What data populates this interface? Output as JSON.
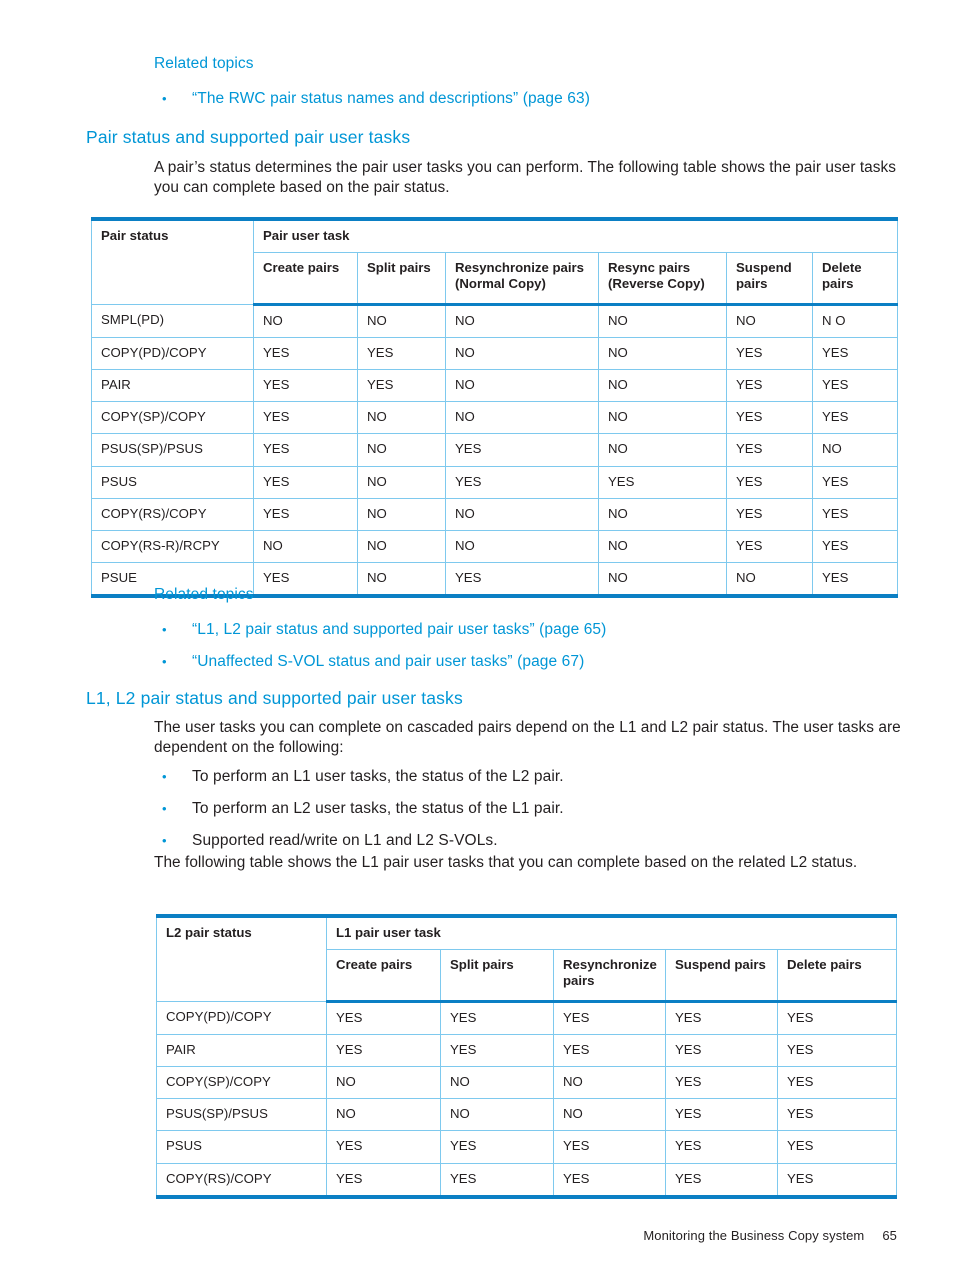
{
  "page": {
    "footer_title": "Monitoring the Business Copy system",
    "footer_page_number": "65",
    "accent_color": "#0096d6",
    "table_rule_color": "#0b7fc4",
    "table_grid_color": "#7ec9ee"
  },
  "related_topics_1": {
    "label": "Related topics",
    "items": [
      {
        "bullet": "•",
        "text": "“The RWC pair status names and descriptions” (page 63)"
      }
    ]
  },
  "section_1": {
    "heading": "Pair status and supported pair user tasks",
    "intro": "A pair’s status determines the pair user tasks you can perform. The following table shows the pair user tasks you can complete based on the pair status."
  },
  "table_1": {
    "row_header_label": "Pair status",
    "group_header_label": "Pair user task",
    "columns": [
      "Create pairs",
      "Split pairs",
      "Resynchronize pairs (Normal Copy)",
      "Resync pairs (Reverse Copy)",
      "Suspend pairs",
      "Delete pairs"
    ],
    "columns_wrapped": [
      [
        "Create pairs"
      ],
      [
        "Split pairs"
      ],
      [
        "Resynchronize pairs",
        "(Normal Copy)"
      ],
      [
        "Resync pairs",
        "(Reverse Copy)"
      ],
      [
        "Suspend",
        "pairs"
      ],
      [
        "Delete",
        "pairs"
      ]
    ],
    "rows": [
      {
        "status": "SMPL(PD)",
        "values": [
          "NO",
          "NO",
          "NO",
          "NO",
          "NO",
          "N O"
        ]
      },
      {
        "status": "COPY(PD)/COPY",
        "values": [
          "YES",
          "YES",
          "NO",
          "NO",
          "YES",
          "YES"
        ]
      },
      {
        "status": "PAIR",
        "values": [
          "YES",
          "YES",
          "NO",
          "NO",
          "YES",
          "YES"
        ]
      },
      {
        "status": "COPY(SP)/COPY",
        "values": [
          "YES",
          "NO",
          "NO",
          "NO",
          "YES",
          "YES"
        ]
      },
      {
        "status": "PSUS(SP)/PSUS",
        "values": [
          "YES",
          "NO",
          "YES",
          "NO",
          "YES",
          "NO"
        ]
      },
      {
        "status": "PSUS",
        "values": [
          "YES",
          "NO",
          "YES",
          "YES",
          "YES",
          "YES"
        ]
      },
      {
        "status": "COPY(RS)/COPY",
        "values": [
          "YES",
          "NO",
          "NO",
          "NO",
          "YES",
          "YES"
        ]
      },
      {
        "status": "COPY(RS-R)/RCPY",
        "values": [
          "NO",
          "NO",
          "NO",
          "NO",
          "YES",
          "YES"
        ]
      },
      {
        "status": "PSUE",
        "values": [
          "YES",
          "NO",
          "YES",
          "NO",
          "NO",
          "YES"
        ]
      }
    ]
  },
  "related_topics_2": {
    "label": "Related topics",
    "items": [
      {
        "bullet": "•",
        "text": "“L1, L2 pair status and supported pair user tasks” (page 65)"
      },
      {
        "bullet": "•",
        "text": "“Unaffected S-VOL status and pair user tasks” (page 67)"
      }
    ]
  },
  "section_2": {
    "heading": "L1, L2 pair status and supported pair user tasks",
    "intro": "The user tasks you can complete on cascaded pairs depend on the L1 and L2 pair status. The user tasks are dependent on the following:",
    "bullets": [
      {
        "bullet": "•",
        "text": "To perform an L1 user tasks, the status of the L2 pair."
      },
      {
        "bullet": "•",
        "text": "To perform an L2 user tasks, the status of the L1 pair."
      },
      {
        "bullet": "•",
        "text": "Supported read/write on L1 and L2 S-VOLs."
      }
    ],
    "outro": "The following table shows the L1 pair user tasks that you can complete based on the related L2 status."
  },
  "table_2": {
    "row_header_label": "L2 pair status",
    "group_header_label": "L1 pair user task",
    "columns": [
      "Create pairs",
      "Split pairs",
      "Resynchronize pairs",
      "Suspend pairs",
      "Delete pairs"
    ],
    "columns_wrapped": [
      [
        "Create pairs"
      ],
      [
        "Split pairs"
      ],
      [
        "Resynchronize",
        "pairs"
      ],
      [
        "Suspend pairs"
      ],
      [
        "Delete pairs"
      ]
    ],
    "rows": [
      {
        "status": "COPY(PD)/COPY",
        "values": [
          "YES",
          "YES",
          "YES",
          "YES",
          "YES"
        ]
      },
      {
        "status": "PAIR",
        "values": [
          "YES",
          "YES",
          "YES",
          "YES",
          "YES"
        ]
      },
      {
        "status": "COPY(SP)/COPY",
        "values": [
          "NO",
          "NO",
          "NO",
          "YES",
          "YES"
        ]
      },
      {
        "status": "PSUS(SP)/PSUS",
        "values": [
          "NO",
          "NO",
          "NO",
          "YES",
          "YES"
        ]
      },
      {
        "status": "PSUS",
        "values": [
          "YES",
          "YES",
          "YES",
          "YES",
          "YES"
        ]
      },
      {
        "status": "COPY(RS)/COPY",
        "values": [
          "YES",
          "YES",
          "YES",
          "YES",
          "YES"
        ]
      }
    ]
  }
}
